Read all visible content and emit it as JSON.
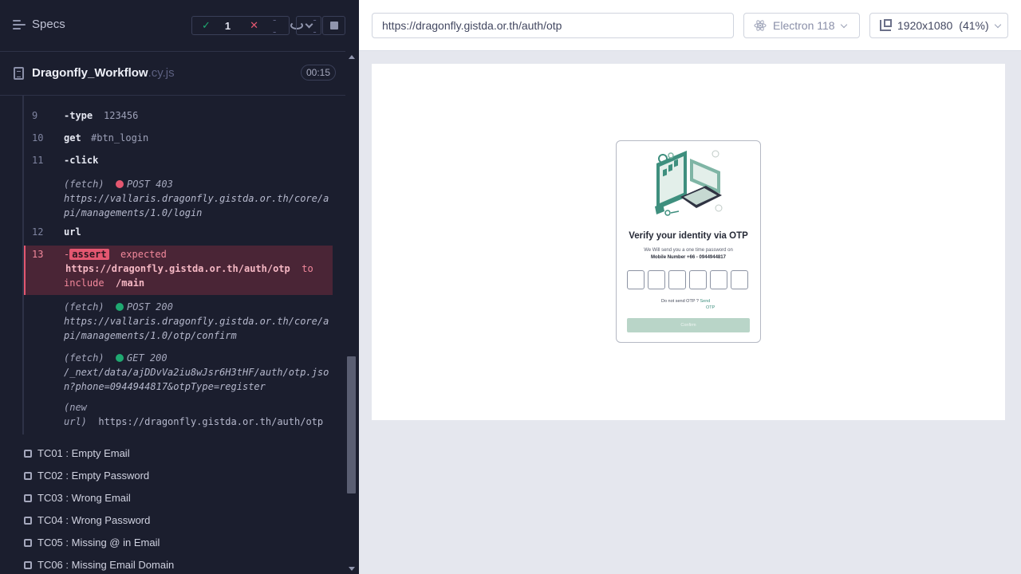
{
  "reporter": {
    "specs_label": "Specs",
    "stats": {
      "passed": "1",
      "failed": "--",
      "pending": "--"
    },
    "spec": {
      "name": "Dragonfly_Workflow",
      "ext": ".cy.js",
      "duration": "00:15"
    },
    "commands": [
      {
        "num": "9",
        "name": "-type",
        "message": "123456"
      },
      {
        "num": "10",
        "name": "get",
        "message": "#btn_login"
      },
      {
        "num": "11",
        "name": "-click",
        "message": ""
      },
      {
        "fetch_label": "(fetch)",
        "status": "POST 403",
        "url1": "https://vallaris.dragonfly.gistda.or.th/core/a",
        "url2": "pi/managements/1.0/login"
      },
      {
        "num": "12",
        "name": "url",
        "message": ""
      },
      {
        "num": "13",
        "name": "-",
        "chip": "assert",
        "line1": "expected",
        "line2_url": "https://dragonfly.gistda.or.th/auth/otp",
        "line2_to": "to",
        "line3_include": "include",
        "line3_val": "/main"
      },
      {
        "fetch_label": "(fetch)",
        "status": "POST 200",
        "url1": "https://vallaris.dragonfly.gistda.or.th/core/a",
        "url2": "pi/managements/1.0/otp/confirm"
      },
      {
        "fetch_label": "(fetch)",
        "status": "GET 200",
        "url1": "/_next/data/ajDDvVa2iu8wJsr6H3tHF/auth/otp.jso",
        "url2": "n?phone=0944944817&otpType=register"
      },
      {
        "label1": "(new",
        "label2": "url)",
        "url": "https://dragonfly.gistda.or.th/auth/otp"
      }
    ],
    "tests": [
      "TC01 : Empty Email",
      "TC02 : Empty Password",
      "TC03 : Wrong Email",
      "TC04 : Wrong Password",
      "TC05 : Missing @ in Email",
      "TC06 : Missing Email Domain"
    ]
  },
  "aut": {
    "url": "https://dragonfly.gistda.or.th/auth/otp",
    "browser": "Electron 118",
    "viewport": "1920x1080",
    "scale": "(41%)",
    "page": {
      "title": "Verify your identity via OTP",
      "sub1": "We Will send you a one time password on",
      "sub2": "Mobile Number +66 - 0944944817",
      "resend_text": "Do not send OTP ?",
      "resend_link_1": "Send",
      "resend_link_2": "OTP",
      "confirm": "Confirm"
    }
  },
  "colors": {
    "pass": "#1fa971",
    "fail": "#e45770",
    "brand_teal": "#3e8f7e"
  }
}
